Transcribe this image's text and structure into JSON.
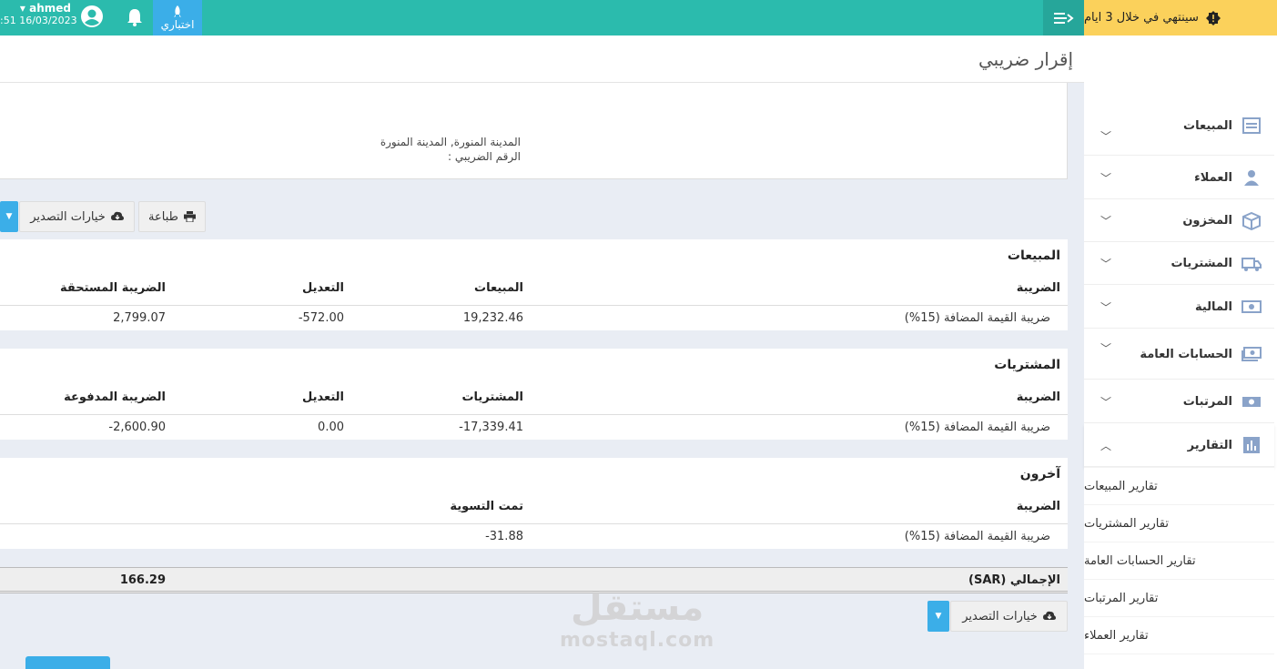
{
  "topbar": {
    "trial_label": "اختباري",
    "user_name": "ahmed",
    "datetime": ":51 16/03/2023"
  },
  "warning": {
    "text": "سينتهي في خلال 3 ايام"
  },
  "sidebar": {
    "items": [
      {
        "label": "المبيعات",
        "icon": "receipt-icon",
        "chevron": "down"
      },
      {
        "label": "العملاء",
        "icon": "user-icon",
        "chevron": "down"
      },
      {
        "label": "المخزون",
        "icon": "box-icon",
        "chevron": "down"
      },
      {
        "label": "المشتريات",
        "icon": "truck-icon",
        "chevron": "down"
      },
      {
        "label": "المالية",
        "icon": "money-icon",
        "chevron": "down"
      },
      {
        "label": "الحسابات العامة",
        "icon": "money-stack-icon",
        "chevron": "down"
      },
      {
        "label": "المرتبات",
        "icon": "cash-icon",
        "chevron": "down"
      },
      {
        "label": "التقارير",
        "icon": "bar-chart-icon",
        "chevron": "up"
      }
    ],
    "submenu": [
      "تقارير المبيعات",
      "تقارير المشتريات",
      "تقارير الحسابات العامة",
      "تقارير المرتبات",
      "تقارير العملاء"
    ]
  },
  "page": {
    "title": "إقرار ضريبي"
  },
  "company": {
    "address": "المدينة المنورة, المدينة المنورة",
    "tax_number": "الرقم الضريبي :"
  },
  "toolbar": {
    "print_label": "طباعة",
    "export_label": "خيارات التصدير"
  },
  "sales": {
    "title": "المبيعات",
    "headers": [
      "الضريبة",
      "المبيعات",
      "التعديل",
      "الضريبة المستحقة"
    ],
    "row": [
      "ضريبة القيمة المضافة (15%)",
      "19,232.46",
      "-572.00",
      "2,799.07"
    ]
  },
  "purchases": {
    "title": "المشتريات",
    "headers": [
      "الضريبة",
      "المشتريات",
      "التعديل",
      "الضريبة المدفوعة"
    ],
    "row": [
      "ضريبة القيمة المضافة (15%)",
      "-17,339.41",
      "0.00",
      "-2,600.90"
    ]
  },
  "others": {
    "title": "آخرون",
    "headers": [
      "الضريبة",
      "تمت التسوية"
    ],
    "row": [
      "ضريبة القيمة المضافة (15%)",
      "-31.88"
    ]
  },
  "total": {
    "label": "الإجمالي (SAR)",
    "value": "166.29"
  },
  "watermark": {
    "arabic": "مستقل",
    "latin": "mostaql.com"
  }
}
